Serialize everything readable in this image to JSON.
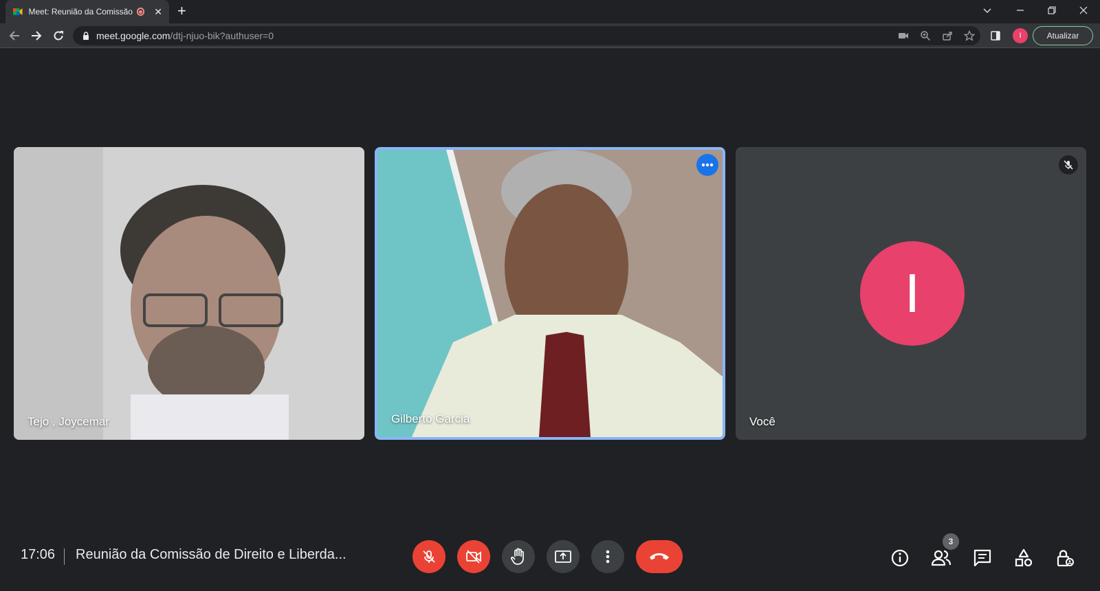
{
  "browser": {
    "tab_title": "Meet: Reunião da Comissão de Direito e Liberdade",
    "tab_title_visible": "Meet: Reunião da Comissão",
    "url_host": "meet.google.com",
    "url_path": "/dtj-njuo-bik?authuser=0",
    "profile_initial": "I",
    "update_label": "Atualizar"
  },
  "participants": [
    {
      "name": "Tejo , Joycemar"
    },
    {
      "name": "Gilberto Garcia"
    },
    {
      "name": "Você",
      "initial": "I"
    }
  ],
  "bottom_bar": {
    "time": "17:06",
    "meeting_title": "Reunião da Comissão de Direito e Liberda...",
    "people_count": "3"
  },
  "colors": {
    "accent_blue": "#1a73e8",
    "end_call_red": "#ea4335",
    "avatar_pink": "#e8416b",
    "background": "#202124"
  }
}
